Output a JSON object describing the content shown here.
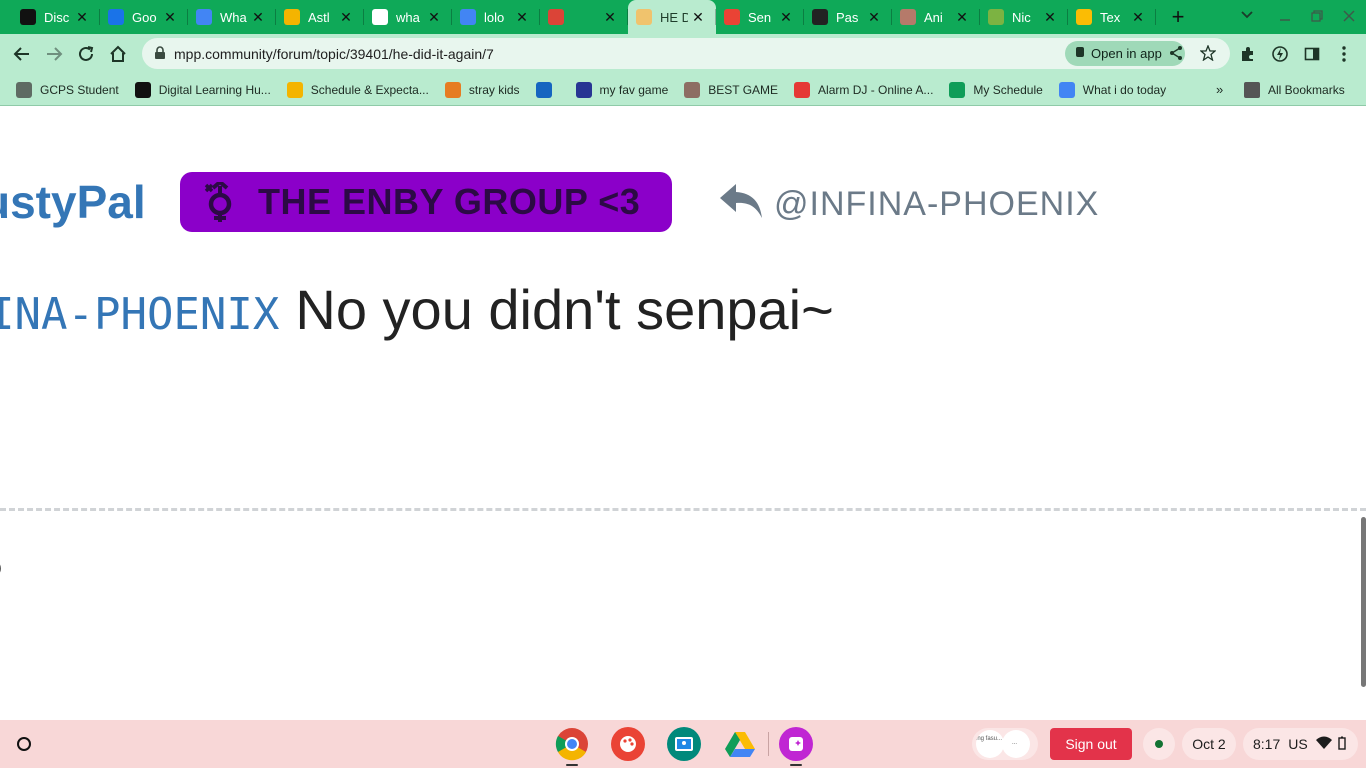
{
  "tabs": [
    {
      "title": "Disc",
      "icon": "d2l-icon",
      "color": "#111111"
    },
    {
      "title": "Goo",
      "icon": "google-docs-icon",
      "color": "#1a73e8"
    },
    {
      "title": "Wha",
      "icon": "google-docs-icon",
      "color": "#4285f4"
    },
    {
      "title": "Astl",
      "icon": "google-slides-icon",
      "color": "#f4b400"
    },
    {
      "title": "wha",
      "icon": "google-icon",
      "color": "#ffffff"
    },
    {
      "title": "lolo",
      "icon": "google-docs-icon",
      "color": "#4285f4"
    },
    {
      "title": "",
      "icon": "multicolor-app-icon",
      "color": "#db4437"
    },
    {
      "title": "HE D",
      "icon": "mpp-icon",
      "color": "#f0c36d"
    },
    {
      "title": "Sen",
      "icon": "gmail-icon",
      "color": "#ea4335"
    },
    {
      "title": "Pas",
      "icon": "info-icon",
      "color": "#222222"
    },
    {
      "title": "Ani",
      "icon": "avatar-icon",
      "color": "#b57a6a"
    },
    {
      "title": "Nic",
      "icon": "plant-icon",
      "color": "#7cb342"
    },
    {
      "title": "Tex",
      "icon": "text-t-icon",
      "color": "#fbbc04"
    }
  ],
  "active_tab_index": 7,
  "toolbar": {
    "url": "mpp.community/forum/topic/39401/he-did-it-again/7",
    "open_in_app": "Open in app"
  },
  "bookmarks": [
    {
      "label": "GCPS Student",
      "icon": "folder-outline-icon"
    },
    {
      "label": "Digital Learning Hu...",
      "icon": "d2l-icon"
    },
    {
      "label": "Schedule & Expecta...",
      "icon": "google-slides-icon"
    },
    {
      "label": "stray kids",
      "icon": "pinterest-icon"
    },
    {
      "label": "",
      "icon": "edge-e-icon"
    },
    {
      "label": "my fav game",
      "icon": "game-icon"
    },
    {
      "label": "BEST GAME",
      "icon": "face-icon"
    },
    {
      "label": "Alarm DJ - Online A...",
      "icon": "alarm-icon"
    },
    {
      "label": "My Schedule",
      "icon": "google-sheets-icon"
    },
    {
      "label": "What i do today",
      "icon": "google-docs-icon"
    }
  ],
  "all_bookmarks": "All Bookmarks",
  "post": {
    "username": "ustyPal",
    "group": "THE ENBY GROUP <3",
    "reply_to": "@INFINA-PHOENIX",
    "mention": "INA-PHOENIX",
    "text": "No you didn't senpai~"
  },
  "shelf": {
    "sign_out": "Sign out",
    "date": "Oct 2",
    "time": "8:17",
    "locale": "US",
    "holding_text_1": "ing fasu...",
    "holding_text_2": "..."
  },
  "colors": {
    "tabstrip": "#0fa958",
    "toolbar": "#b9ebcf",
    "username": "#3476b6",
    "group_badge": "#8b00c9",
    "sign_out": "#e3334a"
  }
}
